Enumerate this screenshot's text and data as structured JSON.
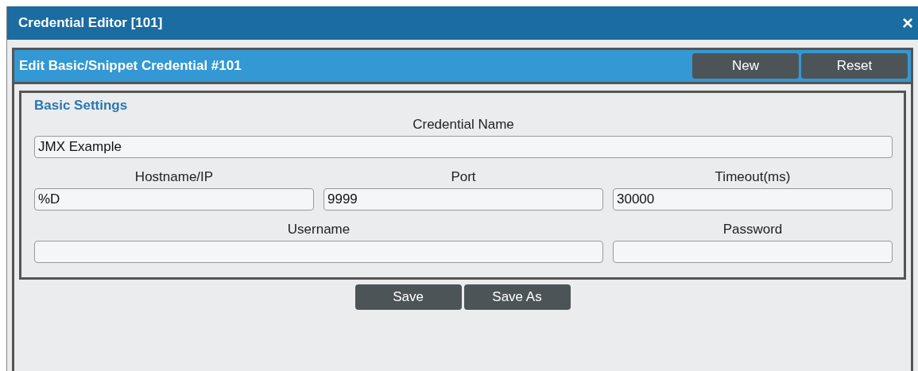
{
  "window": {
    "title": "Credential Editor [101]",
    "close": "×"
  },
  "panel": {
    "title": "Edit Basic/Snippet Credential #101",
    "buttons": [
      "New",
      "Reset"
    ]
  },
  "section": {
    "title": "Basic Settings"
  },
  "rows": [
    {
      "fields": [
        {
          "label": "Credential Name",
          "value": "JMX Example"
        }
      ]
    },
    {
      "fields": [
        {
          "label": "Hostname/IP",
          "value": "%D"
        },
        {
          "label": "Port",
          "value": "9999"
        },
        {
          "label": "Timeout(ms)",
          "value": "30000"
        }
      ]
    },
    {
      "fields": [
        {
          "label": "Username"
        },
        {
          "label": "Password"
        }
      ]
    }
  ],
  "footer_buttons": [
    "Save",
    "Save As"
  ]
}
